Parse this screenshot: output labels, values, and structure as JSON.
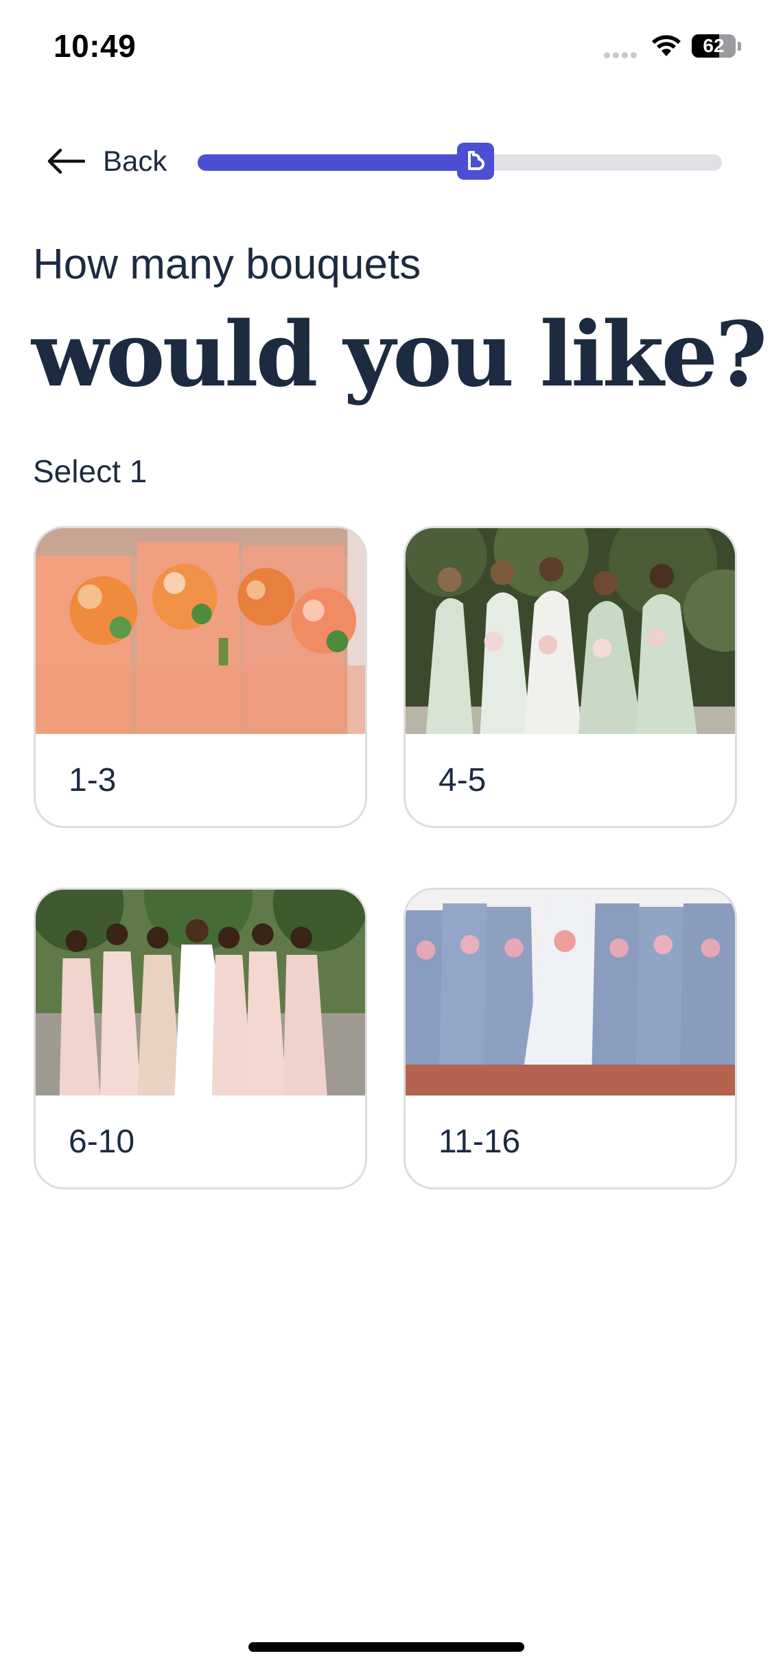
{
  "status_bar": {
    "time": "10:49",
    "battery_level": "62",
    "icons": [
      "cellular-signal-icon",
      "wifi-icon",
      "battery-icon"
    ]
  },
  "nav": {
    "back_label": "Back",
    "back_icon": "arrow-left-icon",
    "progress_percent": 53,
    "progress_thumb_icon": "heart-logo-icon",
    "accent_color": "#4a4fd4"
  },
  "question": {
    "subtitle": "How many bouquets",
    "title": "would you like?",
    "hint": "Select 1"
  },
  "options": [
    {
      "label": "1-3"
    },
    {
      "label": "4-5"
    },
    {
      "label": "6-10"
    },
    {
      "label": "11-16"
    }
  ]
}
